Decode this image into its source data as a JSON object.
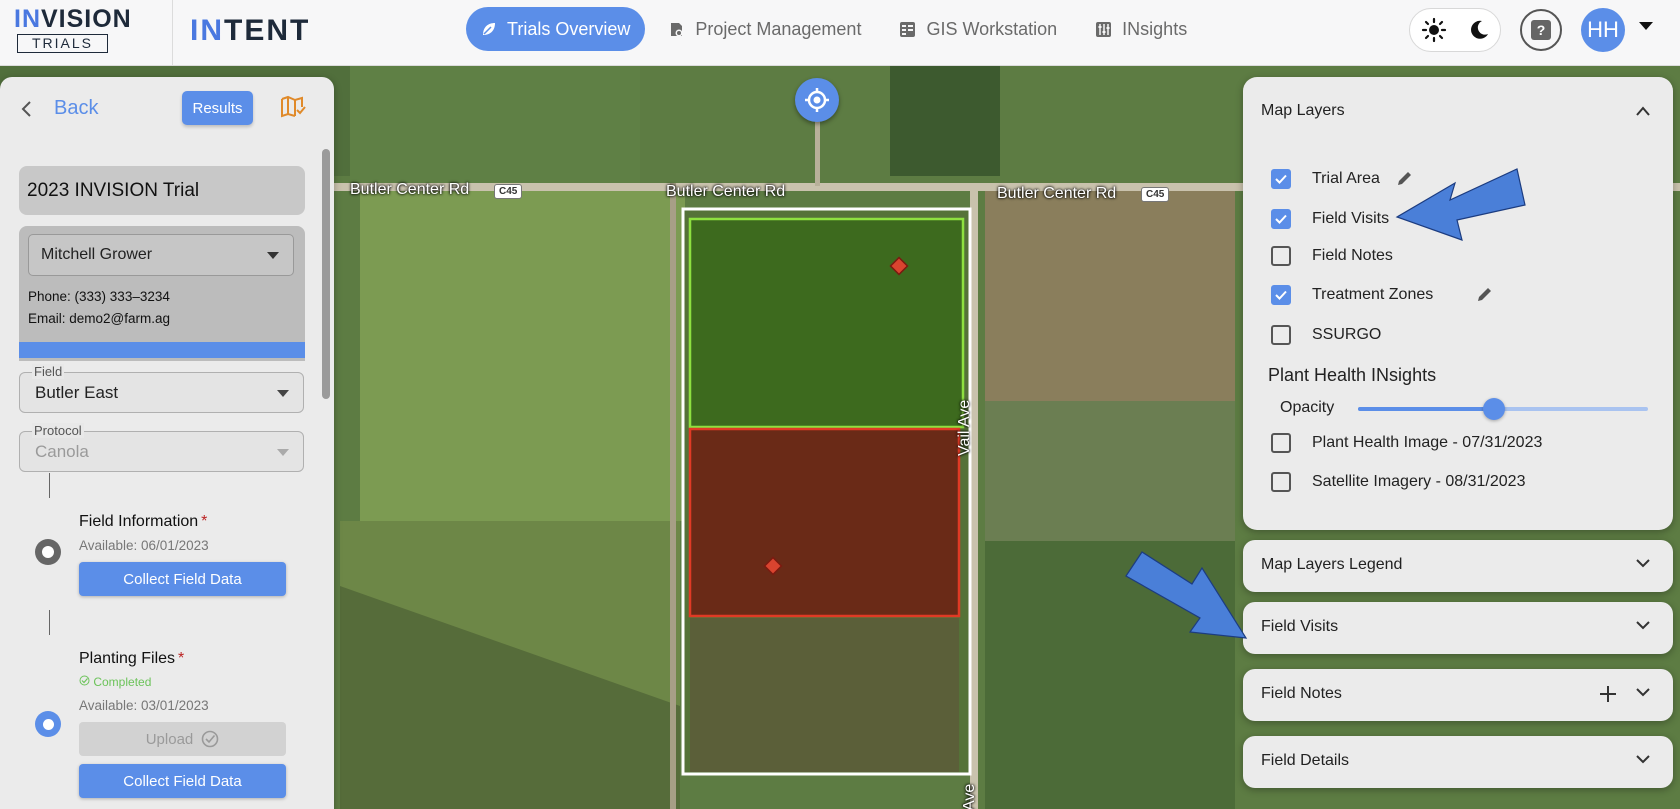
{
  "header": {
    "brand": {
      "in": "IN",
      "rest": "VISION",
      "sub": "TRIALS"
    },
    "app_name": {
      "in": "IN",
      "rest": "TENT"
    },
    "nav": [
      {
        "label": "Trials Overview",
        "icon": "leaf-icon",
        "active": true
      },
      {
        "label": "Project Management",
        "icon": "project-gear-icon",
        "active": false
      },
      {
        "label": "GIS Workstation",
        "icon": "gis-grid-icon",
        "active": false
      },
      {
        "label": "INsights",
        "icon": "sliders-icon",
        "active": false
      }
    ],
    "user_initials": "HH"
  },
  "left_panel": {
    "back_label": "Back",
    "results_label": "Results",
    "trial_name": "2023 INVISION Trial",
    "grower": "Mitchell Grower",
    "phone": "Phone: (333) 333–3234",
    "email": "Email: demo2@farm.ag",
    "field_label": "Field",
    "field_value": "Butler East",
    "protocol_label": "Protocol",
    "protocol_value": "Canola",
    "steps": [
      {
        "title": "Field Information",
        "required": "*",
        "available": "Available: 06/01/2023",
        "button": "Collect Field Data"
      },
      {
        "title": "Planting Files",
        "required": "*",
        "status": "Completed",
        "available": "Available: 03/01/2023",
        "upload": "Upload",
        "button": "Collect Field Data"
      }
    ]
  },
  "map": {
    "roads": [
      "Butler Center Rd",
      "Butler Center Rd",
      "Butler Center Rd",
      "Vail Ave",
      "Ave"
    ],
    "route_badge": "C45"
  },
  "map_layers": {
    "title": "Map Layers",
    "layers": [
      {
        "label": "Trial Area",
        "checked": true,
        "editable": true
      },
      {
        "label": "Field Visits",
        "checked": true,
        "editable": false
      },
      {
        "label": "Field Notes",
        "checked": false,
        "editable": false
      },
      {
        "label": "Treatment Zones",
        "checked": true,
        "editable": true
      },
      {
        "label": "SSURGO",
        "checked": false,
        "editable": false
      }
    ],
    "plant_health_title": "Plant Health INsights",
    "opacity_label": "Opacity",
    "opacity_value": 0.47,
    "imagery": [
      {
        "label": "Plant Health Image - 07/31/2023",
        "checked": false
      },
      {
        "label": "Satellite Imagery - 08/31/2023",
        "checked": false
      }
    ]
  },
  "accordions": [
    {
      "label": "Map Layers Legend"
    },
    {
      "label": "Field Visits"
    },
    {
      "label": "Field Notes",
      "has_add": true
    },
    {
      "label": "Field Details"
    }
  ],
  "colors": {
    "accent": "#5b8ee8",
    "zone_green": "#8ee040",
    "zone_red": "#e03a25",
    "arrow": "#4a7fd8"
  }
}
